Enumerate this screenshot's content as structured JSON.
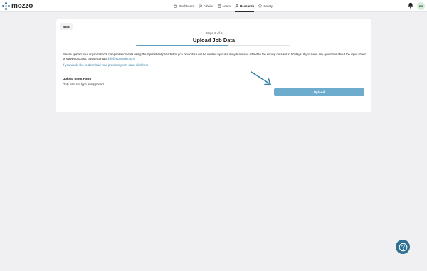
{
  "brand": {
    "name": "mozzo"
  },
  "nav": {
    "items": [
      {
        "label": "Dashboard",
        "icon": "calendar-icon"
      },
      {
        "label": "Advice",
        "icon": "chat-icon"
      },
      {
        "label": "Learn",
        "icon": "book-icon"
      },
      {
        "label": "Research",
        "icon": "search-icon",
        "active": true
      },
      {
        "label": "Safety",
        "icon": "shield-icon"
      }
    ]
  },
  "header": {
    "avatar_initials": "DS"
  },
  "page": {
    "back_label": "Back",
    "steps_text": "Steps 3 of 5",
    "title": "Upload Job Data",
    "progress": 0.6,
    "description": "Please upload your organization's compensation data using the input sheet provided to you. Your data will be verified by our survey team and added to the survey data set in 90 days. If you have any questions about the input sheet or survey process, please contact",
    "contact_email": "info@ecrtengln.com.",
    "download_text": "If you would like to download your previous years data, click here.",
    "form_label": "Upload Input Form",
    "form_note": "Only .xlsx file type is supported.",
    "upload_label": "Upload"
  },
  "colors": {
    "accent": "#2f7fa6",
    "upload_button": "#6daccc",
    "help_button": "#2f7093"
  }
}
